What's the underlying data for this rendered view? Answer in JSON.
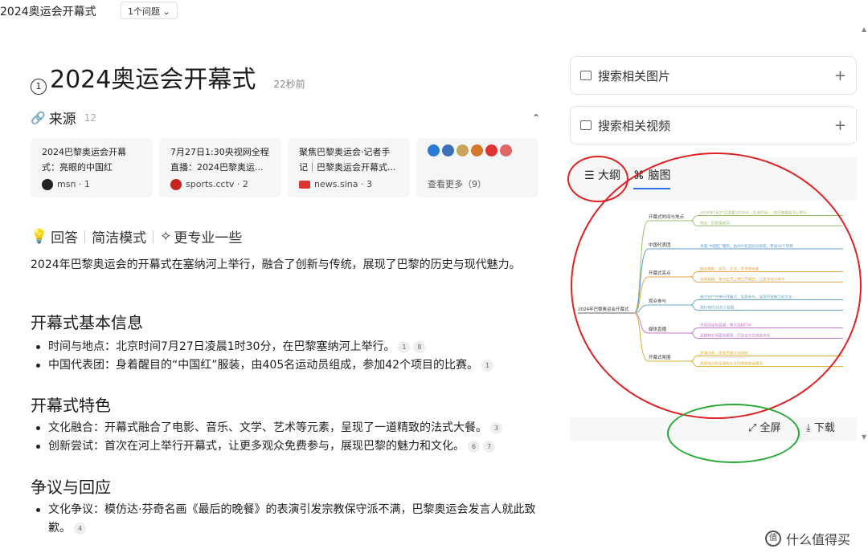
{
  "topbar": {
    "title": "2024奥运会开幕式",
    "issues": "1个问题"
  },
  "header": {
    "title": "2024奥运会开幕式",
    "ago": "22秒前"
  },
  "sources": {
    "label": "来源",
    "count": "12",
    "cards": [
      {
        "text": "2024巴黎奥运会开幕式：亮眼的中国红",
        "src": "msn · 1",
        "color": "#222"
      },
      {
        "text": "7月27日1:30央视网全程直播：2024巴黎奥运...",
        "src": "sports.cctv · 2",
        "color": "#c5251f"
      },
      {
        "text": "聚焦巴黎奥运会·记者手记｜巴黎奥运会开幕式...",
        "src": "news.sina · 3",
        "color": "#d33"
      }
    ],
    "more": "查看更多（9）",
    "more_logo_colors": [
      "#2a7bd8",
      "#3b6fb6",
      "#c9a45a",
      "#d4782c",
      "#d33",
      "#e06666"
    ]
  },
  "answer": {
    "label": "回答",
    "mode1": "简洁模式",
    "mode2": "更专业一些"
  },
  "intro": "2024年巴黎奥运会的开幕式在塞纳河上举行，融合了创新与传统，展现了巴黎的历史与现代魅力。",
  "sections": [
    {
      "title": "开幕式基本信息",
      "items": [
        {
          "text": "时间与地点：北京时间7月27日凌晨1时30分，在巴黎塞纳河上举行。",
          "refs": [
            "1",
            "8"
          ]
        },
        {
          "text": "中国代表团：身着醒目的“中国红”服装，由405名运动员组成，参加42个项目的比赛。",
          "refs": [
            "1"
          ]
        }
      ]
    },
    {
      "title": "开幕式特色",
      "items": [
        {
          "text": "文化融合：开幕式融合了电影、音乐、文学、艺术等元素，呈现了一道精致的法式大餐。",
          "refs": [
            "3"
          ]
        },
        {
          "text": "创新尝试：首次在河上举行开幕式，让更多观众免费参与，展现巴黎的魅力和文化。",
          "refs": [
            "6",
            "7"
          ]
        }
      ]
    },
    {
      "title": "争议与回应",
      "items": [
        {
          "text": "文化争议：模仿达·芬奇名画《最后的晚餐》的表演引发宗教保守派不满，巴黎奥运会发言人就此致歉。",
          "refs": [
            "4"
          ]
        }
      ]
    }
  ],
  "right": {
    "search_images": "搜索相关图片",
    "search_videos": "搜索相关视频",
    "tab_outline": "大纲",
    "tab_mindmap": "脑图",
    "fullscreen": "全屏",
    "download": "下载",
    "mindmap": {
      "root": "2024年巴黎奥运会开幕式",
      "branches": [
        {
          "label": "开幕式时间与地点",
          "color": "#9bbf6b",
          "leaves": [
            "2024年7月27日凌晨1时30分（北京时间），在巴黎塞纳河上举行",
            "地点：巴黎塞纳河"
          ]
        },
        {
          "label": "中国代表团",
          "color": "#5b9bd5",
          "leaves": [
            "身着“中国红”服装，由405名运动员组成，参加42个项目"
          ]
        },
        {
          "label": "开幕式亮点",
          "color": "#e3a64b",
          "leaves": [
            "融合电影、音乐、文学、艺术等元素",
            "全球直播，首次在河上举行开幕式，让更多观众参与"
          ]
        },
        {
          "label": "观众参与",
          "color": "#6aa7c9",
          "leaves": [
            "首次在户外举行开幕式，免费参与，展现巴黎魅力和文化",
            "预计有约50万人观看"
          ]
        },
        {
          "label": "媒体直播",
          "color": "#c77dc7",
          "leaves": [
            "央视网全程直播，腾讯视频同步",
            "直播精彩场面和赛事，打造全方位观看体验"
          ]
        },
        {
          "label": "开幕式氛围",
          "color": "#e0b030",
          "leaves": [
            "充满创意，体现巴黎文化特色",
            "现场观众和全球观众共同感受奥运盛况"
          ]
        }
      ]
    }
  },
  "watermark": "什么值得买",
  "annotations": {
    "red": "#e02020",
    "green": "#22aa33"
  }
}
